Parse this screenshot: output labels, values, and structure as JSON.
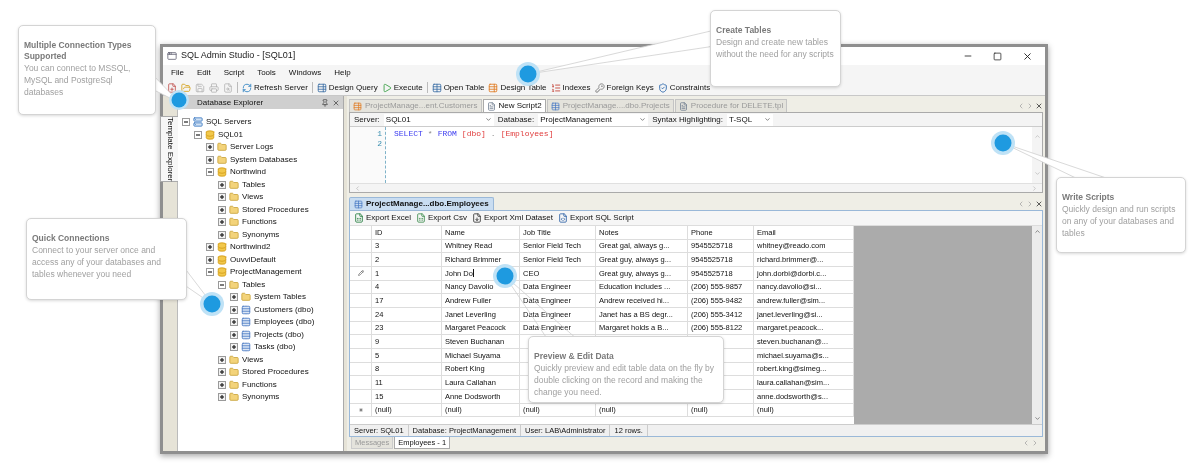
{
  "window": {
    "title": "SQL Admin Studio - [SQL01]"
  },
  "menu": [
    "File",
    "Edit",
    "Script",
    "Tools",
    "Windows",
    "Help"
  ],
  "toolbar": {
    "icon_buttons": [
      {
        "kind": "new",
        "disabled": false
      },
      {
        "kind": "open",
        "disabled": false
      },
      {
        "kind": "save",
        "disabled": true
      },
      {
        "kind": "print",
        "disabled": true
      },
      {
        "kind": "preview",
        "disabled": true
      }
    ],
    "buttons": [
      {
        "kind": "separator"
      },
      {
        "label": "Refresh Server",
        "kind": "refresh"
      },
      {
        "kind": "separator"
      },
      {
        "label": "Design Query",
        "kind": "design-query"
      },
      {
        "label": "Execute",
        "kind": "execute"
      },
      {
        "kind": "separator"
      },
      {
        "label": "Open Table",
        "kind": "open-table"
      },
      {
        "label": "Design Table",
        "kind": "design-table"
      },
      {
        "label": "Indexes",
        "kind": "indexes"
      },
      {
        "label": "Foreign Keys",
        "kind": "foreign-keys"
      },
      {
        "label": "Constraints",
        "kind": "constraints"
      }
    ]
  },
  "side_tab": "Template Explorer",
  "explorer": {
    "title": "Database Explorer",
    "tree": [
      {
        "label": "SQL Servers",
        "kind": "servers",
        "expanded": true,
        "children": [
          {
            "label": "SQL01",
            "kind": "server",
            "expanded": true,
            "children": [
              {
                "label": "Server Logs",
                "kind": "folder",
                "expanded": false
              },
              {
                "label": "System Databases",
                "kind": "folder",
                "expanded": false
              },
              {
                "label": "Northwind",
                "kind": "database",
                "expanded": true,
                "children": [
                  {
                    "label": "Tables",
                    "kind": "folder",
                    "expanded": false
                  },
                  {
                    "label": "Views",
                    "kind": "folder",
                    "expanded": false
                  },
                  {
                    "label": "Stored Procedures",
                    "kind": "folder",
                    "expanded": false
                  },
                  {
                    "label": "Functions",
                    "kind": "folder",
                    "expanded": false
                  },
                  {
                    "label": "Synonyms",
                    "kind": "folder",
                    "expanded": false
                  }
                ]
              },
              {
                "label": "Northwind2",
                "kind": "database",
                "expanded": false
              },
              {
                "label": "OuvviDefault",
                "kind": "database",
                "expanded": false
              },
              {
                "label": "ProjectManagement",
                "kind": "database",
                "expanded": true,
                "children": [
                  {
                    "label": "Tables",
                    "kind": "folder",
                    "expanded": true,
                    "children": [
                      {
                        "label": "System Tables",
                        "kind": "folder",
                        "expanded": false
                      },
                      {
                        "label": "Customers (dbo)",
                        "kind": "table",
                        "expanded": false
                      },
                      {
                        "label": "Employees (dbo)",
                        "kind": "table",
                        "expanded": false
                      },
                      {
                        "label": "Projects (dbo)",
                        "kind": "table",
                        "expanded": false
                      },
                      {
                        "label": "Tasks (dbo)",
                        "kind": "table",
                        "expanded": false
                      }
                    ]
                  },
                  {
                    "label": "Views",
                    "kind": "folder",
                    "expanded": false
                  },
                  {
                    "label": "Stored Procedures",
                    "kind": "folder",
                    "expanded": false
                  },
                  {
                    "label": "Functions",
                    "kind": "folder",
                    "expanded": false
                  },
                  {
                    "label": "Synonyms",
                    "kind": "folder",
                    "expanded": false
                  }
                ]
              }
            ]
          }
        ]
      }
    ]
  },
  "editor": {
    "tabs": [
      {
        "label": "ProjectManage...ent.Customers",
        "kind": "table-design",
        "selected": false
      },
      {
        "label": "New Script2",
        "kind": "script",
        "selected": true
      },
      {
        "label": "ProjectManage....dbo.Projects",
        "kind": "table",
        "selected": false
      },
      {
        "label": "Procedure for DELETE.tpl",
        "kind": "script",
        "selected": false
      }
    ],
    "server_label": "Server:",
    "server": "SQL01",
    "database_label": "Database:",
    "database": "ProjectManagement",
    "syntax_label": "Syntax Highlighting:",
    "syntax": "T-SQL",
    "lines": [
      {
        "number": "1",
        "tokens": [
          {
            "kind": "keyword",
            "text": "SELECT"
          },
          {
            "kind": "operator",
            "text": "*"
          },
          {
            "kind": "keyword",
            "text": "FROM"
          },
          {
            "kind": "identifier",
            "text": "[dbo]"
          },
          {
            "kind": "operator",
            "text": "."
          },
          {
            "kind": "identifier",
            "text": "[Employees]"
          }
        ]
      },
      {
        "number": "2"
      }
    ]
  },
  "results": {
    "tab": "ProjectManage...dbo.Employees",
    "exports": [
      {
        "label": "Export Excel",
        "kind": "excel"
      },
      {
        "label": "Export Csv",
        "kind": "csv"
      },
      {
        "label": "Export Xml Dataset",
        "kind": "xml"
      },
      {
        "label": "Export SQL Script",
        "kind": "sql"
      }
    ],
    "columns": [
      "ID",
      "Name",
      "Job Title",
      "Notes",
      "Phone",
      "Email"
    ],
    "rows": [
      {
        "editing": false,
        "cells": [
          "3",
          "Whitney Read",
          "Senior Field Tech",
          "Great gal, always g...",
          "9545525718",
          "whitney@reado.com"
        ]
      },
      {
        "editing": false,
        "cells": [
          "2",
          "Richard Brimmer",
          "Senior Field Tech",
          "Great guy, always g...",
          "9545525718",
          "richard.brimmer@..."
        ]
      },
      {
        "editing": true,
        "cells": [
          "1",
          "John Do",
          "CEO",
          "Great guy, always g...",
          "9545525718",
          "john.dorbi@dorbi.c..."
        ]
      },
      {
        "editing": false,
        "cells": [
          "4",
          "Nancy Davolio",
          "Data Engineer",
          "Education includes ...",
          "(206) 555-9857",
          "nancy.davolio@si..."
        ]
      },
      {
        "editing": false,
        "cells": [
          "17",
          "Andrew Fuller",
          "Data Engineer",
          "Andrew received hi...",
          "(206) 555-9482",
          "andrew.fuller@sim..."
        ]
      },
      {
        "editing": false,
        "cells": [
          "24",
          "Janet Leverling",
          "Data Engineer",
          "Janet has a BS degr...",
          "(206) 555-3412",
          "janet.leverling@si..."
        ]
      },
      {
        "editing": false,
        "cells": [
          "23",
          "Margaret Peacock",
          "Data Engineer",
          "Margaret holds a B...",
          "(206) 555-8122",
          "margaret.peacock..."
        ]
      },
      {
        "editing": false,
        "cells": [
          "9",
          "Steven Buchanan",
          null,
          null,
          null,
          "steven.buchanan@..."
        ]
      },
      {
        "editing": false,
        "cells": [
          "5",
          "Michael Suyama",
          null,
          null,
          null,
          "michael.suyama@s..."
        ]
      },
      {
        "editing": false,
        "cells": [
          "8",
          "Robert King",
          null,
          null,
          null,
          "robert.king@simeg..."
        ]
      },
      {
        "editing": false,
        "cells": [
          "11",
          "Laura Callahan",
          null,
          null,
          null,
          "laura.callahan@sim..."
        ]
      },
      {
        "editing": false,
        "cells": [
          "15",
          "Anne Dodsworth",
          null,
          null,
          null,
          "anne.dodsworth@s..."
        ]
      },
      {
        "editing": false,
        "cells": [
          "(null)",
          "(null)",
          "(null)",
          "(null)",
          "(null)",
          "(null)"
        ]
      }
    ],
    "new_row": true,
    "status": [
      "Server: SQL01",
      "Database: ProjectManagement",
      "User: LAB\\Administrator",
      "12 rows."
    ],
    "bottom_tabs": [
      {
        "label": "Messages",
        "selected": false
      },
      {
        "label": "Employees - 1",
        "selected": true
      }
    ]
  },
  "callouts": [
    {
      "title": "Multiple Connection Types Supported",
      "text": "You can connect to MSSQL, MySQL and PostgreSql databases"
    },
    {
      "title": "Create Tables",
      "text": "Design and create new tables without the need for any scripts"
    },
    {
      "title": "Write Scripts",
      "text": "Quickly design and run scripts on any of your databases and tables"
    },
    {
      "title": "Quick Connections",
      "text": "Connect to your server once and access any of your databases and tables whenever you need"
    },
    {
      "title": "Preview & Edit Data",
      "text": "Quickly preview and edit table data on the fly by double clicking on the record and making the change you need."
    }
  ]
}
